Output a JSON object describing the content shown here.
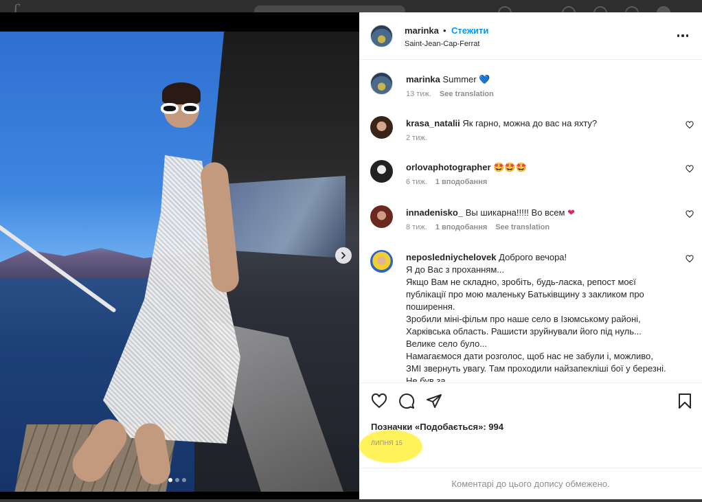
{
  "post": {
    "username": "marinka",
    "follow_label": "Стежити",
    "location": "Saint-Jean-Cap-Ferrat",
    "caption_user": "marinka",
    "caption_text": "Summer",
    "caption_emoji": "💙",
    "caption_time": "13 тиж.",
    "caption_translate": "See translation",
    "likes_label": "Позначки «Подобається»: 994",
    "date": "ЛИПНЯ 15",
    "comments_limited": "Коментарі до цього допису обмежено.",
    "carousel": {
      "slides": 3,
      "active": 1
    }
  },
  "comments": [
    {
      "user": "krasa_natalii",
      "text": "Як гарно, можна до вас на яхту?",
      "time": "2 тиж.",
      "likes": "",
      "translate": ""
    },
    {
      "user": "orlovaphotographer",
      "text": "🤩🤩🤩",
      "time": "6 тиж.",
      "likes": "1 вподобання",
      "translate": ""
    },
    {
      "user": "innadenisko_",
      "text": "Вы шикарна!!!!! Во всем",
      "emoji": "❤",
      "time": "8 тиж.",
      "likes": "1 вподобання",
      "translate": "See translation"
    },
    {
      "user": "neposledniychelovek",
      "text": "Доброго вечора!",
      "lines": [
        "Я до Вас з проханням...",
        "Якщо Вам не складно, зробіть, будь-ласка, репост моєї публікації про мою маленьку Батьківщину з закликом про поширення.",
        "Зробили міні-фільм про наше село в Ізюмському районі, Харківська область. Рашисти зруйнували його під нуль... Велике село було...",
        "Намагаємося дати розголос, щоб нас не забули і, можливо, ЗМІ звернуть увагу. Там проходили найзапекліші бої у березні. Не був за"
      ]
    }
  ],
  "colors": {
    "follow": "#0095f6",
    "text": "#262626",
    "muted": "#8e8e8e",
    "highlight": "#fff25a"
  },
  "icons": [
    "heart-icon",
    "comment-icon",
    "share-icon",
    "bookmark-icon",
    "more-icon",
    "chevron-right-icon"
  ]
}
